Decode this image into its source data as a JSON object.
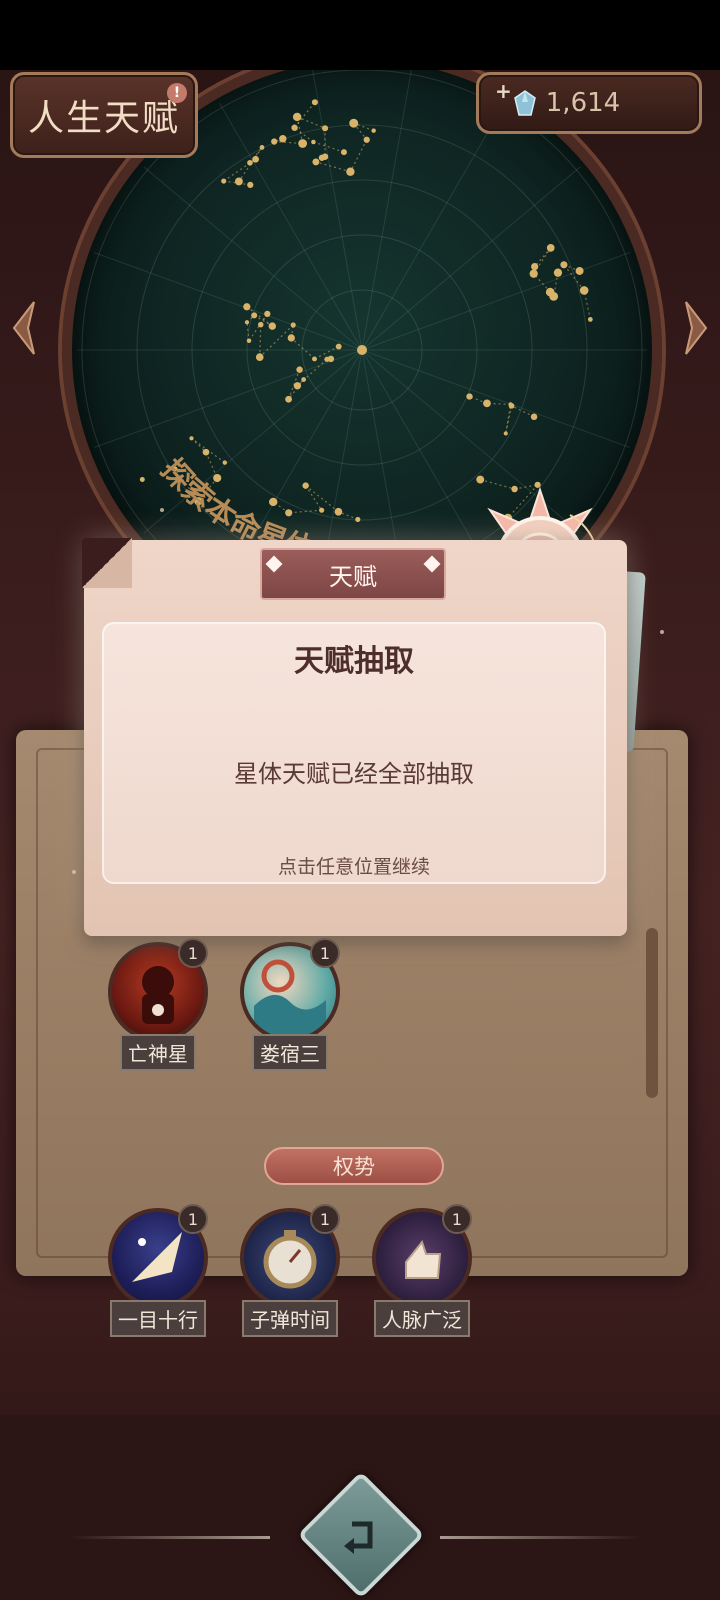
{
  "header": {
    "title": "人生天赋",
    "alert_mark": "!",
    "currency_plus": "+",
    "currency_amount": "1,614"
  },
  "star_map": {
    "arc_label": "探索本命星体"
  },
  "modal": {
    "tab_label": "天赋",
    "title": "天赋抽取",
    "message": "星体天赋已经全部抽取",
    "hint": "点击任意位置继续"
  },
  "talents": {
    "row1": [
      {
        "name": "亡神星",
        "count": "1"
      },
      {
        "name": "娄宿三",
        "count": "1"
      }
    ],
    "category": "权势",
    "row2": [
      {
        "name": "一目十行",
        "count": "1"
      },
      {
        "name": "子弹时间",
        "count": "1"
      },
      {
        "name": "人脉广泛",
        "count": "1"
      }
    ]
  },
  "colors": {
    "background": "#3b1d1d",
    "panel": "#9c8066",
    "modal": "#efd6c8",
    "accent": "#9a5d5a",
    "star_gold": "#d9b36a"
  },
  "icons": {
    "back": "back-arrow-icon",
    "gem": "crystal-gem-icon"
  }
}
